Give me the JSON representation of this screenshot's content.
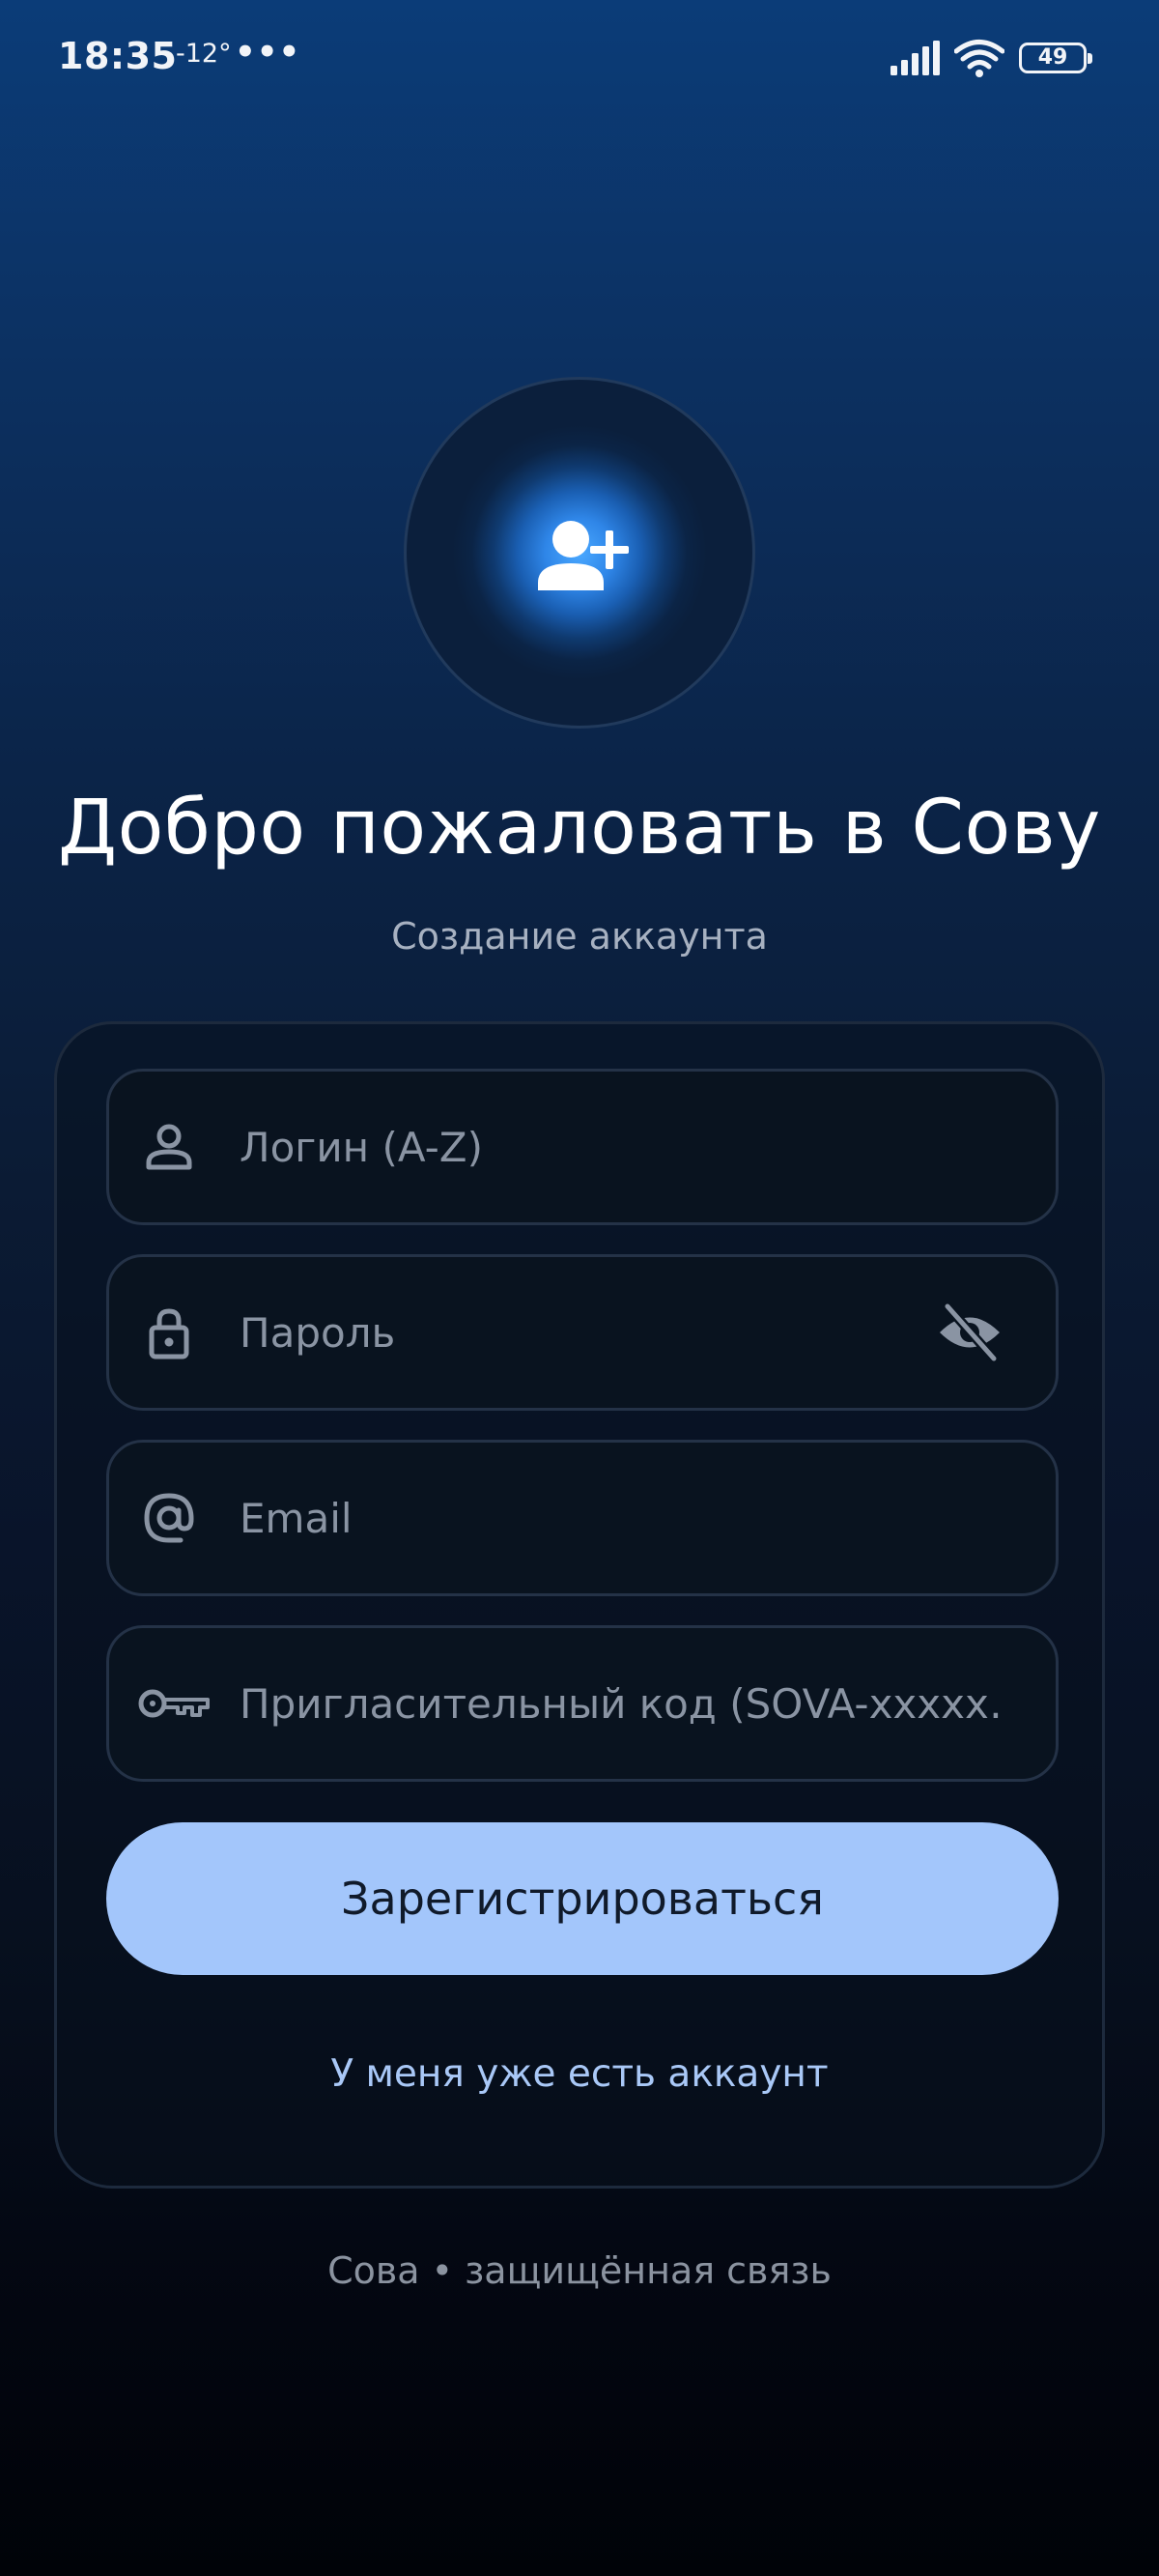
{
  "status_bar": {
    "time": "18:35",
    "temperature": "-12°",
    "more_indicator": "•••",
    "battery_level": "49"
  },
  "avatar": {
    "icon": "person-add-icon"
  },
  "header": {
    "title": "Добро пожаловать в Сову",
    "subtitle": "Создание аккаунта"
  },
  "form": {
    "login_placeholder": "Логин (A-Z)",
    "login_icon": "person-icon",
    "password_placeholder": "Пароль",
    "password_icon": "lock-icon",
    "password_toggle_icon": "eye-off-icon",
    "email_placeholder": "Email",
    "email_icon": "at-icon",
    "invite_placeholder": "Пригласительный код (SOVA-xxxxx…",
    "invite_icon": "key-icon",
    "submit_label": "Зарегистрироваться",
    "login_link": "У меня уже есть аккаунт"
  },
  "footer": {
    "text": "Сова • защищённая связь"
  },
  "colors": {
    "accent_button": "#a3c6fb",
    "link": "#a9c8f7",
    "glow": "#4aa8ff"
  }
}
